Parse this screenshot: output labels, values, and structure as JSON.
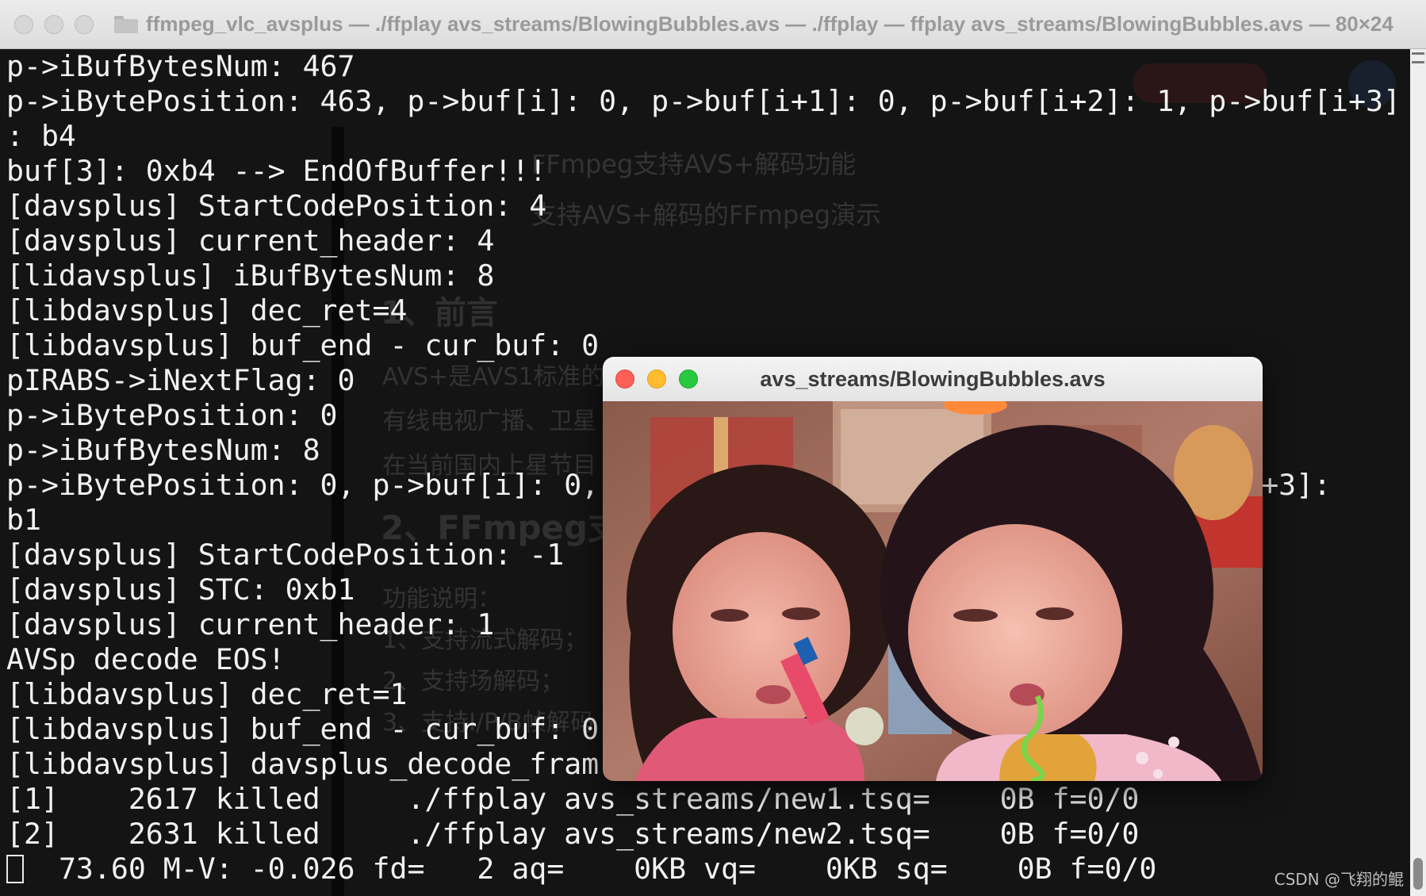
{
  "terminal": {
    "title": "ffmpeg_vlc_avsplus — ./ffplay avs_streams/BlowingBubbles.avs — ./ffplay — ffplay avs_streams/BlowingBubbles.avs — 80×24",
    "lines": [
      "p->iBufBytesNum: 467",
      "p->iBytePosition: 463, p->buf[i]: 0, p->buf[i+1]: 0, p->buf[i+2]: 1, p->buf[i+3]",
      ": b4",
      "buf[3]: 0xb4 --> EndOfBuffer!!!",
      "[davsplus] StartCodePosition: 4",
      "[davsplus] current_header: 4",
      "[lidavsplus] iBufBytesNum: 8",
      "[libdavsplus] dec_ret=4",
      "[libdavsplus] buf_end - cur_buf: 0",
      "pIRABS->iNextFlag: 0",
      "p->iBytePosition: 0",
      "p->iBufBytesNum: 8",
      "p->iBytePosition: 0, p->buf[i]: 0,                                   f[i+3]:",
      "b1",
      "[davsplus] StartCodePosition: -1",
      "[davsplus] STC: 0xb1",
      "[davsplus] current_header: 1",
      "AVSp decode EOS!",
      "[libdavsplus] dec_ret=1",
      "[libdavsplus] buf_end - cur_buf: 0",
      "[libdavsplus] davsplus_decode_fram",
      "[1]    2617 killed     ./ffplay avs_streams/new1.tsq=    0B f=0/0",
      "[2]    2631 killed     ./ffplay avs_streams/new2.tsq=    0B f=0/0"
    ],
    "status_line": "  73.60 M-V: -0.026 fd=   2 aq=    0KB vq=    0KB sq=    0B f=0/0"
  },
  "background_page": {
    "heading_1": "FFmpeg支持AVS+解码功能",
    "heading_2": "支持AVS+解码的FFmpeg演示",
    "section_1": "1、前言",
    "section_2": "2、FFmpeg支",
    "paragraphs": [
      "AVS+是AVS1标准的",
      "有线电视广播、卫星",
      "在当前国内上星节目",
      "功能说明：",
      "1、支持流式解码；",
      "2、支持场解码；",
      "3、支持I/P/B帧解码"
    ]
  },
  "video_window": {
    "title": "avs_streams/BlowingBubbles.avs"
  },
  "watermark": "CSDN @飞翔的鲲",
  "colors": {
    "terminal_bg": "#141414",
    "terminal_text": "#f2f2f2",
    "close": "#fe5f57",
    "minimize": "#febc2e",
    "maximize": "#28c840"
  }
}
